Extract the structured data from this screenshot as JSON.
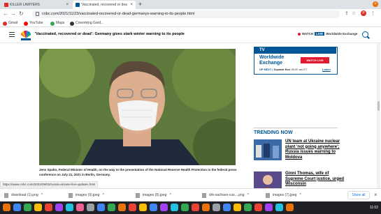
{
  "browser": {
    "tabs": [
      {
        "title": "KILLER LAWYERS",
        "favicon_color": "#d93025"
      },
      {
        "title": "'Vaccinated, recovered or dea",
        "favicon_color": "#005594"
      }
    ],
    "new_tab_label": "+",
    "url": "cnbc.com/2021/11/23/vaccinated-recovered-or-dead-germanys-warning-to-its-people.html",
    "profile_initial": "P",
    "bookmarks": [
      {
        "label": "Gmail",
        "color": "#d93025"
      },
      {
        "label": "YouTube",
        "color": "#ff0000"
      },
      {
        "label": "Maps",
        "color": "#34a853"
      },
      {
        "label": "Coworking Gard...",
        "color": "#333333"
      }
    ]
  },
  "site": {
    "headline": "'Vaccinated, recovered or dead': Germany gives stark winter warning to its people",
    "watch_label": "WATCH",
    "live_label": "LIVE",
    "channel_label": "Worldwide Exchange"
  },
  "article": {
    "caption_bold": "Jens Spahn, Federal Minister of Health, on the way to the presentation of the National Reserve Health Protection in the federal press conference on July 21, 2021 in Berlin, Germany."
  },
  "tv_promo": {
    "logo": "TV",
    "show_title": "Worldwide Exchange",
    "watch_button": "WATCH LIVE",
    "up_next_label": "UP NEXT",
    "up_next_show": "Squawk Box",
    "up_next_time": "06:00 am ET",
    "listen_label": "Listen"
  },
  "trending": {
    "title": "TRENDING NOW",
    "items": [
      {
        "headline": "UN team at Ukraine nuclear plant 'not going anywhere'; Russia issues warning to Moldova"
      },
      {
        "headline": "Ginni Thomas, wife of Supreme Court justice, urged Wisconsin"
      }
    ]
  },
  "status_url": "https://www.cnbc.com/2022/09/02/russia-ukraine-live-updates.html",
  "downloads": {
    "items": [
      {
        "name": "download (1).png"
      },
      {
        "name": "images (9).jpeg"
      },
      {
        "name": "images (8).jpeg"
      },
      {
        "name": "drk-sachsen-cus....png"
      },
      {
        "name": "images (7).jpeg"
      }
    ],
    "show_all": "Show all"
  },
  "taskbar": {
    "clock": "11:02",
    "icon_colors": [
      "#e8710a",
      "#4285f4",
      "#34a853",
      "#fbbc04",
      "#ea4335",
      "#a142f4",
      "#24c1e0",
      "#f06292",
      "#9aa0a6",
      "#4285f4",
      "#34a853",
      "#e8710a",
      "#ea4335",
      "#fbbc04",
      "#4285f4",
      "#a142f4",
      "#24c1e0",
      "#34a853",
      "#ea4335",
      "#e8710a",
      "#9aa0a6",
      "#4285f4",
      "#fbbc04",
      "#34a853",
      "#ea4335",
      "#a142f4",
      "#24c1e0",
      "#e8710a"
    ]
  }
}
